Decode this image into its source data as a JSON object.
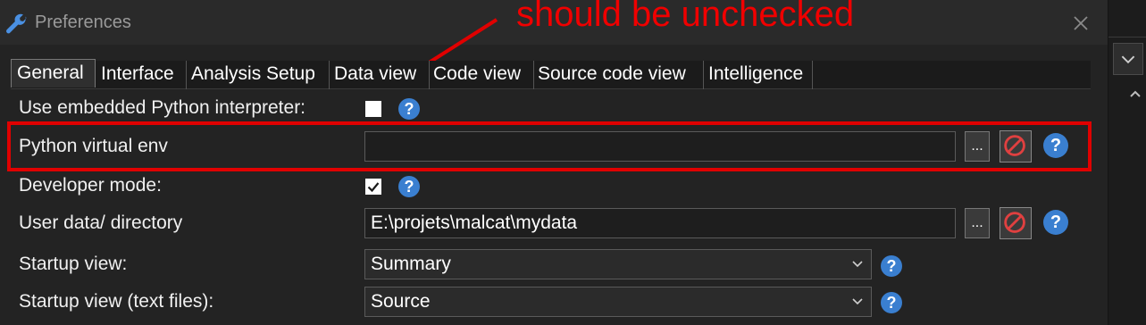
{
  "window": {
    "title": "Preferences",
    "title_icon": "wrench-icon",
    "close_icon": "close-icon"
  },
  "annotation": {
    "text": "should be unchecked",
    "color": "#f00000"
  },
  "tabs": [
    {
      "label": "General",
      "active": true
    },
    {
      "label": "Interface",
      "active": false
    },
    {
      "label": "Analysis Setup",
      "active": false
    },
    {
      "label": "Data view",
      "active": false
    },
    {
      "label": "Code view",
      "active": false
    },
    {
      "label": "Source code view",
      "active": false
    },
    {
      "label": "Intelligence",
      "active": false
    }
  ],
  "settings": {
    "embedded_python": {
      "label": "Use embedded Python interpreter:",
      "checked": false
    },
    "virtual_env": {
      "label": "Python virtual env",
      "value": "",
      "browse_label": "..."
    },
    "developer_mode": {
      "label": "Developer mode:",
      "checked": true
    },
    "user_data_dir": {
      "label": "User data/ directory",
      "value": "E:\\projets\\malcat\\mydata",
      "browse_label": "..."
    },
    "startup_view": {
      "label": "Startup view:",
      "value": "Summary"
    },
    "startup_view_text": {
      "label": "Startup view (text files):",
      "value": "Source"
    }
  },
  "help_label": "?",
  "colors": {
    "accent_red": "#e00000",
    "help_blue": "#3a7fd0",
    "background": "#232323"
  }
}
